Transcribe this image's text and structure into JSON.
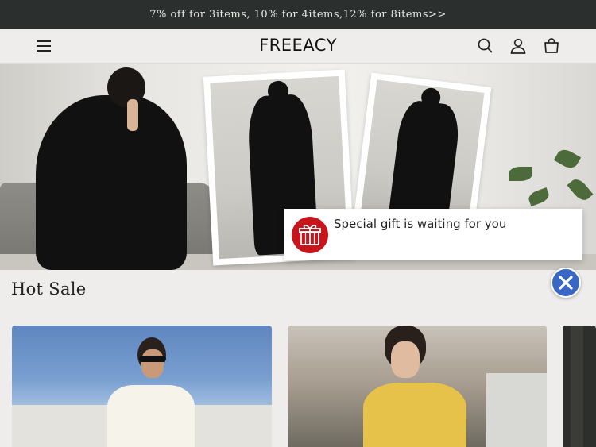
{
  "announcement": {
    "text": "7% off for 3items, 10% for 4items,12% for 8items>>"
  },
  "header": {
    "logo": "FREEACY",
    "icons": [
      "menu-icon",
      "search-icon",
      "account-icon",
      "cart-icon"
    ]
  },
  "hero": {
    "icons": [
      "gift-icon",
      "close-icon"
    ]
  },
  "gift_popup": {
    "text": "Special gift is waiting for you"
  },
  "section": {
    "title": "Hot Sale"
  },
  "colors": {
    "announcement_bg": "#2b302e",
    "page_bg": "#efedeb",
    "gift_red": "#c8151b",
    "close_blue": "#3a67c4"
  }
}
